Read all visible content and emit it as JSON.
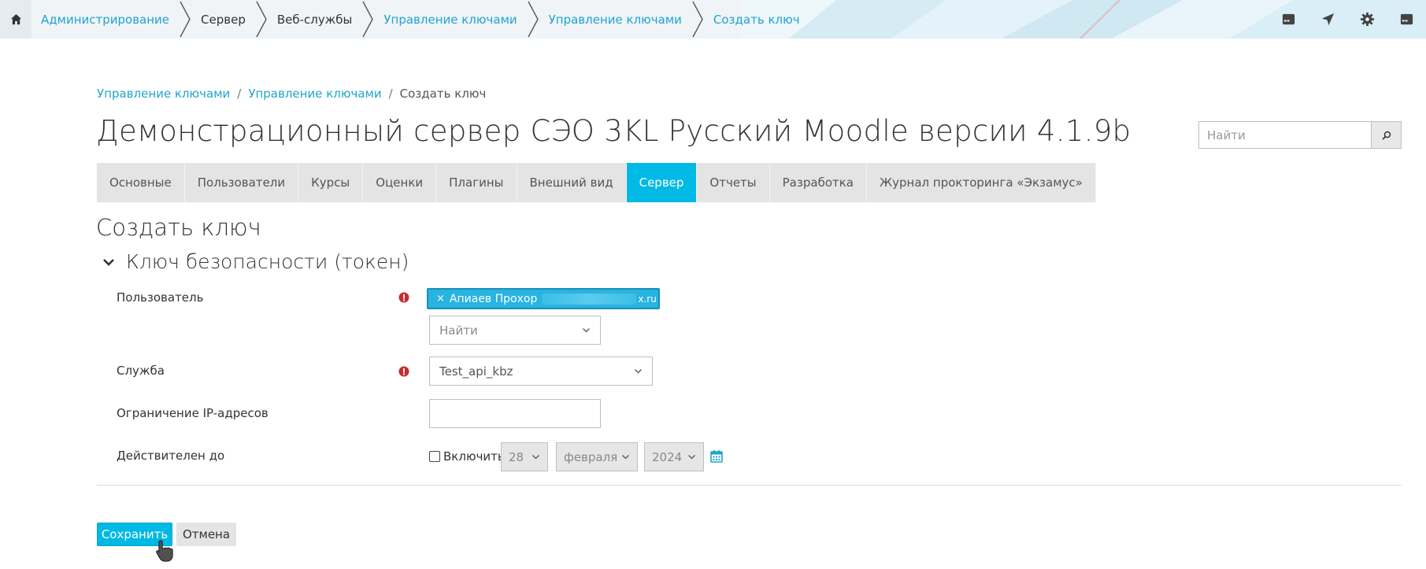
{
  "navbar": {
    "breadcrumbs": [
      {
        "label": "Администрирование",
        "link": true
      },
      {
        "label": "Сервер",
        "link": false
      },
      {
        "label": "Веб-службы",
        "link": false
      },
      {
        "label": "Управление ключами",
        "link": true
      },
      {
        "label": "Управление ключами",
        "link": true
      },
      {
        "label": "Создать ключ",
        "link": true
      }
    ],
    "icons": [
      "home-icon",
      "notes-icon",
      "send-icon",
      "gear-icon",
      "drive-icon"
    ]
  },
  "page_breadcrumb": {
    "items": [
      "Управление ключами",
      "Управление ключами",
      "Создать ключ"
    ],
    "separator": "/"
  },
  "site_title": "Демонстрационный сервер СЭО 3KL Русский Moodle версии 4.1.9b",
  "search": {
    "placeholder": "Найти"
  },
  "tabs": [
    {
      "label": "Основные",
      "active": false
    },
    {
      "label": "Пользователи",
      "active": false
    },
    {
      "label": "Курсы",
      "active": false
    },
    {
      "label": "Оценки",
      "active": false
    },
    {
      "label": "Плагины",
      "active": false
    },
    {
      "label": "Внешний вид",
      "active": false
    },
    {
      "label": "Сервер",
      "active": true
    },
    {
      "label": "Отчеты",
      "active": false
    },
    {
      "label": "Разработка",
      "active": false
    },
    {
      "label": "Журнал прокторинга «Экзамус»",
      "active": false
    }
  ],
  "page_heading": "Создать ключ",
  "section_title": "Ключ безопасности (токен)",
  "form": {
    "user_label": "Пользователь",
    "user_selected": "Апиаев Прохор",
    "user_domain": "x.ru",
    "user_remove": "×",
    "user_search_placeholder": "Найти",
    "service_label": "Служба",
    "service_value": "Test_api_kbz",
    "ip_label": "Ограничение IP-адресов",
    "ip_value": "",
    "valid_label": "Действителен до",
    "enable_label": "Включить",
    "day": "28",
    "month": "февраля",
    "year": "2024"
  },
  "buttons": {
    "save": "Сохранить",
    "cancel": "Отмена"
  },
  "colors": {
    "accent": "#00b9e4",
    "link": "#1fa5cf",
    "required": "#cc2b2b"
  }
}
